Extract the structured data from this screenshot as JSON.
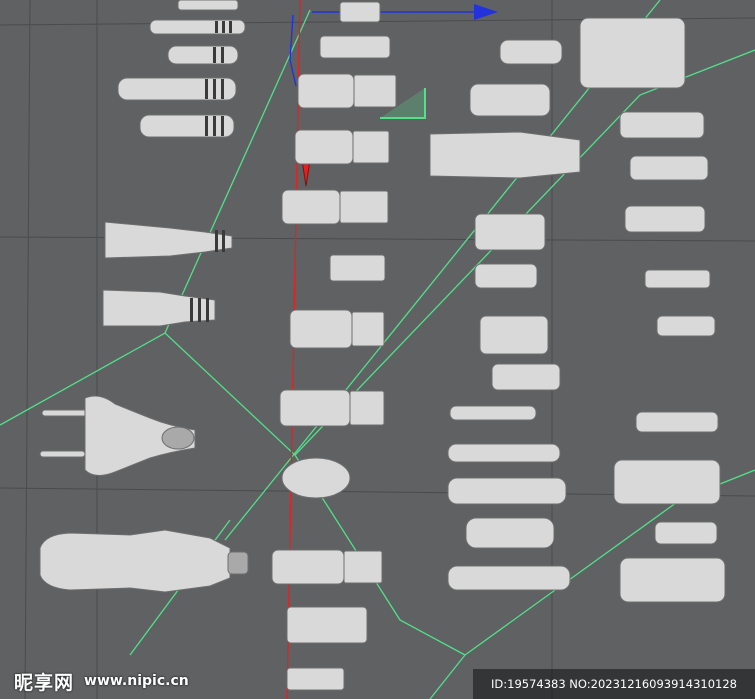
{
  "watermark": {
    "logo": "昵享网",
    "site": "www.nipic.cn",
    "id_line": "ID:19574383 NO:20231216093914310128"
  },
  "colors": {
    "background": "#5f6163",
    "model": "#d9d9d9",
    "axis_x": "#2233dd",
    "axis_y": "#e22222",
    "spline": "#52e08a"
  },
  "icons": [
    "axis-arrow-x-icon",
    "axis-arrow-y-icon",
    "axis-gizmo-icon"
  ]
}
